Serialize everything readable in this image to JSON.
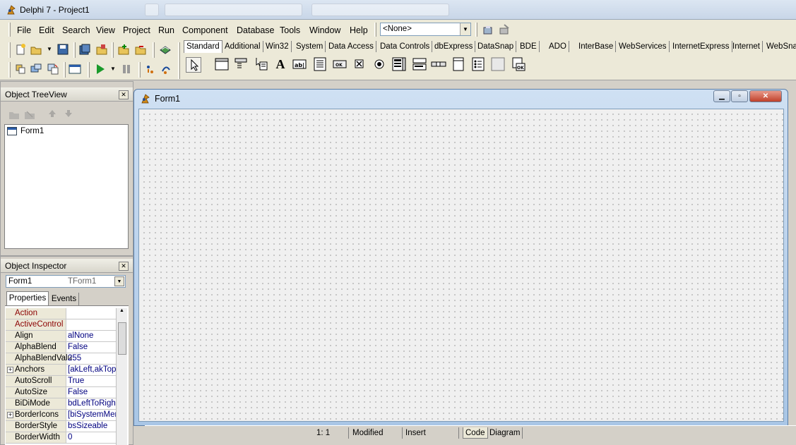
{
  "window": {
    "title": "Delphi 7 - Project1"
  },
  "menu": {
    "items": [
      "File",
      "Edit",
      "Search",
      "View",
      "Project",
      "Run",
      "Component",
      "Database",
      "Tools",
      "Window",
      "Help"
    ]
  },
  "toolbar": {
    "config_combo": "<None>"
  },
  "palette": {
    "tabs": [
      "Standard",
      "Additional",
      "Win32",
      "System",
      "Data Access",
      "Data Controls",
      "dbExpress",
      "DataSnap",
      "BDE",
      "ADO",
      "InterBase",
      "WebServices",
      "InternetExpress",
      "Internet",
      "WebSna"
    ],
    "active_tab": "Standard",
    "component_icons": [
      "pointer-icon",
      "frames-icon",
      "mainmenu-icon",
      "popupmenu-icon",
      "label-icon",
      "edit-icon",
      "memo-icon",
      "button-icon",
      "checkbox-icon",
      "radiobutton-icon",
      "listbox-icon",
      "combobox-icon",
      "scrollbar-icon",
      "groupbox-icon",
      "radiogroup-icon",
      "panel-icon",
      "actionlist-icon"
    ]
  },
  "tree_view": {
    "title": "Object TreeView",
    "items": [
      "Form1"
    ]
  },
  "inspector": {
    "title": "Object Inspector",
    "object_name": "Form1",
    "object_type": "TForm1",
    "tabs": [
      "Properties",
      "Events"
    ],
    "properties": [
      {
        "name": "Action",
        "value": "",
        "expandable": false,
        "highlight": true
      },
      {
        "name": "ActiveControl",
        "value": "",
        "expandable": false,
        "highlight": true
      },
      {
        "name": "Align",
        "value": "alNone",
        "expandable": false,
        "highlight": false
      },
      {
        "name": "AlphaBlend",
        "value": "False",
        "expandable": false,
        "highlight": false
      },
      {
        "name": "AlphaBlendValu",
        "value": "255",
        "expandable": false,
        "highlight": false
      },
      {
        "name": "Anchors",
        "value": "[akLeft,akTop",
        "expandable": true,
        "highlight": false
      },
      {
        "name": "AutoScroll",
        "value": "True",
        "expandable": false,
        "highlight": false
      },
      {
        "name": "AutoSize",
        "value": "False",
        "expandable": false,
        "highlight": false
      },
      {
        "name": "BiDiMode",
        "value": "bdLeftToRigh",
        "expandable": false,
        "highlight": false
      },
      {
        "name": "BorderIcons",
        "value": "[biSystemMen",
        "expandable": true,
        "highlight": false
      },
      {
        "name": "BorderStyle",
        "value": "bsSizeable",
        "expandable": false,
        "highlight": false
      },
      {
        "name": "BorderWidth",
        "value": "0",
        "expandable": false,
        "highlight": false
      }
    ]
  },
  "form": {
    "title": "Form1"
  },
  "editor_status": {
    "position": "1:   1",
    "modified": "Modified",
    "mode": "Insert",
    "tabs": [
      "Code",
      "Diagram"
    ]
  },
  "colors": {
    "highlight_prop": "#8b0000",
    "value_text": "#000080",
    "accent": "#0a246a"
  }
}
